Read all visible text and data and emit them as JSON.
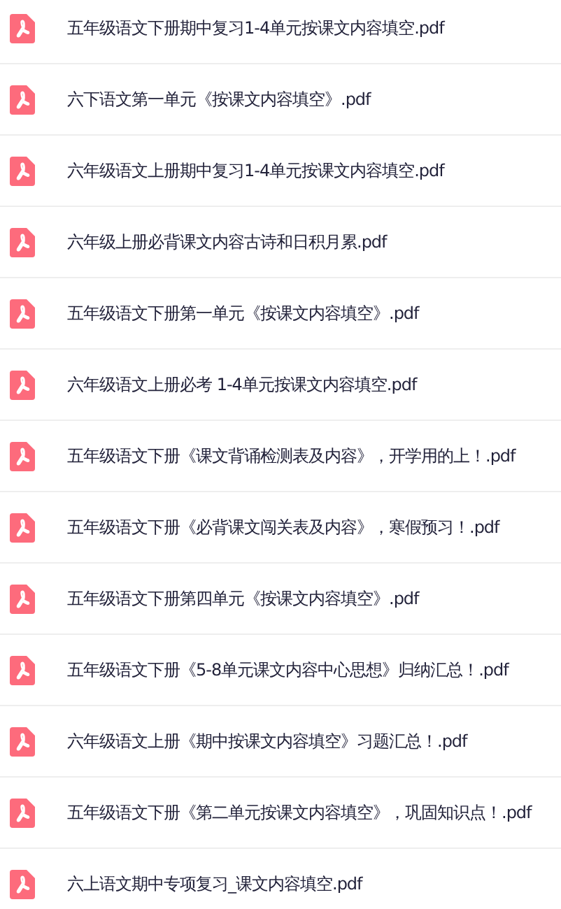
{
  "files": [
    {
      "name": "五年级语文下册期中复习1-4单元按课文内容填空.pdf"
    },
    {
      "name": "六下语文第一单元《按课文内容填空》.pdf"
    },
    {
      "name": "六年级语文上册期中复习1-4单元按课文内容填空.pdf"
    },
    {
      "name": "六年级上册必背课文内容古诗和日积月累.pdf"
    },
    {
      "name": "五年级语文下册第一单元《按课文内容填空》.pdf"
    },
    {
      "name": "六年级语文上册必考 1-4单元按课文内容填空.pdf"
    },
    {
      "name": "五年级语文下册《课文背诵检测表及内容》，开学用的上！.pdf"
    },
    {
      "name": "五年级语文下册《必背课文闯关表及内容》，寒假预习！.pdf"
    },
    {
      "name": "五年级语文下册第四单元《按课文内容填空》.pdf"
    },
    {
      "name": "五年级语文下册《5-8单元课文内容中心思想》归纳汇总！.pdf"
    },
    {
      "name": "六年级语文上册《期中按课文内容填空》习题汇总！.pdf"
    },
    {
      "name": "五年级语文下册《第二单元按课文内容填空》，巩固知识点！.pdf"
    },
    {
      "name": "六上语文期中专项复习_课文内容填空.pdf"
    }
  ]
}
